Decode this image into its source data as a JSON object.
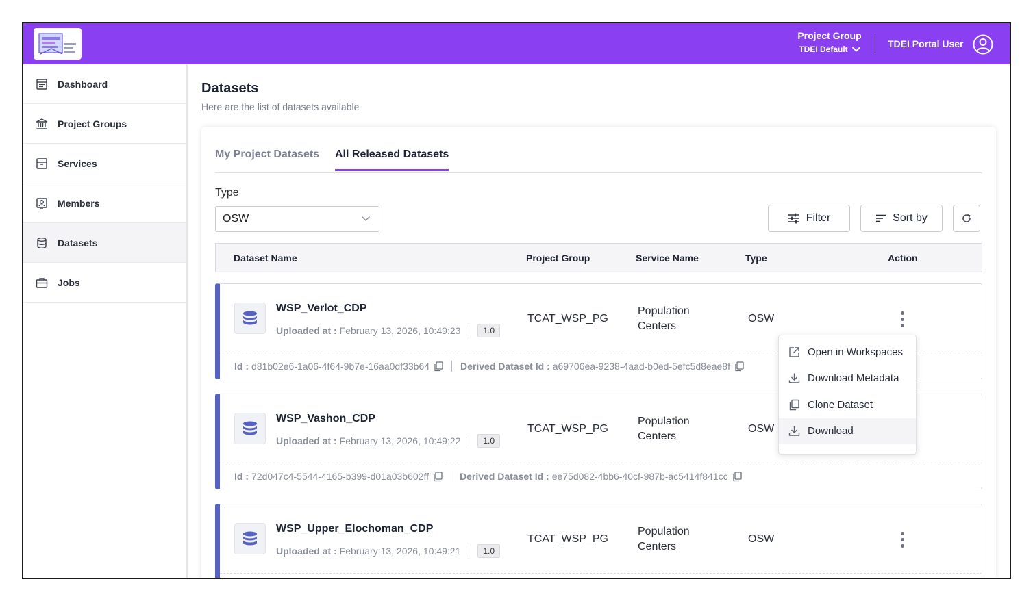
{
  "header": {
    "project_group_title": "Project Group",
    "project_group_value": "TDEI Default",
    "user_name": "TDEI Portal User",
    "accent_color": "#8a3ff0"
  },
  "sidebar": {
    "items": [
      {
        "label": "Dashboard",
        "icon": "dashboard-icon"
      },
      {
        "label": "Project Groups",
        "icon": "bank-icon"
      },
      {
        "label": "Services",
        "icon": "archive-icon"
      },
      {
        "label": "Members",
        "icon": "member-badge-icon"
      },
      {
        "label": "Datasets",
        "icon": "database-icon",
        "active": true
      },
      {
        "label": "Jobs",
        "icon": "briefcase-icon"
      }
    ]
  },
  "page": {
    "title": "Datasets",
    "subtitle": "Here are the list of datasets available"
  },
  "tabs": [
    {
      "label": "My Project Datasets",
      "active": false
    },
    {
      "label": "All Released Datasets",
      "active": true
    }
  ],
  "filters": {
    "type_label": "Type",
    "type_value": "OSW",
    "filter_label": "Filter",
    "sort_label": "Sort by"
  },
  "table": {
    "columns": [
      "Dataset Name",
      "Project Group",
      "Service Name",
      "Type",
      "Action"
    ],
    "rows": [
      {
        "name": "WSP_Verlot_CDP",
        "uploaded_label": "Uploaded at :",
        "uploaded_at": "February 13, 2026, 10:49:23",
        "version": "1.0",
        "project_group": "TCAT_WSP_PG",
        "service_name": "Population Centers",
        "type": "OSW",
        "id_label": "Id :",
        "id": "d81b02e6-1a06-4f64-9b7e-16aa0df33b64",
        "derived_label": "Derived Dataset Id :",
        "derived_id": "a69706ea-9238-4aad-b0ed-5efc5d8eae8f"
      },
      {
        "name": "WSP_Vashon_CDP",
        "uploaded_label": "Uploaded at :",
        "uploaded_at": "February 13, 2026, 10:49:22",
        "version": "1.0",
        "project_group": "TCAT_WSP_PG",
        "service_name": "Population Centers",
        "type": "OSW",
        "id_label": "Id :",
        "id": "72d047c4-5544-4165-b399-d01a03b602ff",
        "derived_label": "Derived Dataset Id :",
        "derived_id": "ee75d082-4bb6-40cf-987b-ac5414f841cc"
      },
      {
        "name": "WSP_Upper_Elochoman_CDP",
        "uploaded_label": "Uploaded at :",
        "uploaded_at": "February 13, 2026, 10:49:21",
        "version": "1.0",
        "project_group": "TCAT_WSP_PG",
        "service_name": "Population Centers",
        "type": "OSW"
      }
    ]
  },
  "action_menu": {
    "items": [
      {
        "label": "Open in Workspaces",
        "icon": "external-link-icon"
      },
      {
        "label": "Download Metadata",
        "icon": "download-icon"
      },
      {
        "label": "Clone Dataset",
        "icon": "copy-icon"
      },
      {
        "label": "Download",
        "icon": "download-icon",
        "hovered": true
      }
    ]
  }
}
